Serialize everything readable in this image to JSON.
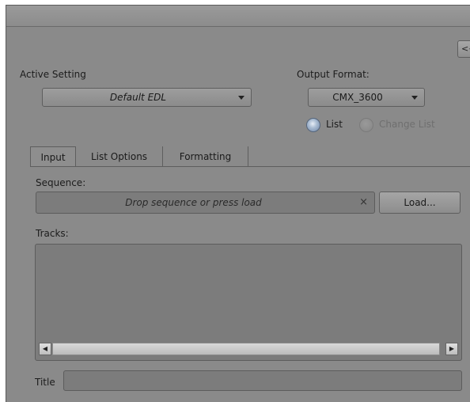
{
  "header": {
    "collapse_label": "<<"
  },
  "active_setting": {
    "label": "Active Setting",
    "value": "Default EDL"
  },
  "output_format": {
    "label": "Output Format:",
    "value": "CMX_3600",
    "radio_list": "List",
    "radio_change_list": "Change List",
    "selected": "List"
  },
  "tabs": [
    {
      "label": "Input",
      "active": true
    },
    {
      "label": "List Options",
      "active": false
    },
    {
      "label": "Formatting",
      "active": false
    }
  ],
  "input_tab": {
    "sequence_label": "Sequence:",
    "sequence_placeholder": "Drop sequence or press load",
    "clear_glyph": "×",
    "load_label": "Load...",
    "tracks_label": "Tracks:",
    "title_label": "Title",
    "title_value": ""
  },
  "icons": {
    "dropdown": "chevron-down-icon",
    "scroll_left": "scroll-left-icon",
    "scroll_right": "scroll-right-icon",
    "clear": "close-icon"
  },
  "colors": {
    "panel": "#8a8a8a",
    "field": "#7c7c7c",
    "radio_selected": "#a9bbd1"
  }
}
